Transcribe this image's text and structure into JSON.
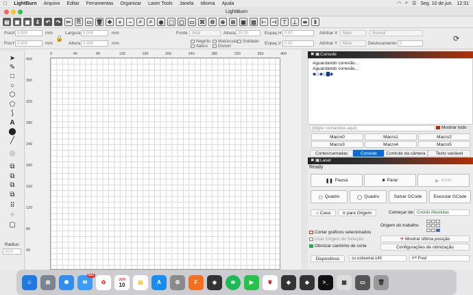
{
  "menubar": {
    "app": "LightBurn",
    "items": [
      "Arquivo",
      "Editar",
      "Ferramentas",
      "Organizar",
      "Laser Tools",
      "Janela",
      "Idioma",
      "Ajuda"
    ],
    "date": "Seg. 10 de jun.",
    "time": "12:31"
  },
  "window": {
    "title": "LightBurn"
  },
  "props": {
    "posx_label": "PosX",
    "posx_value": "0.000",
    "posx_unit": "mm",
    "posy_label": "PosY",
    "posy_value": "0.000",
    "posy_unit": "mm",
    "width_label": "Largura",
    "width_value": "0.000",
    "width_unit": "mm",
    "height_label": "Altura",
    "height_value": "0.000",
    "height_unit": "mm",
    "font_label": "Fonte",
    "font_value": "Arial",
    "alt_label": "Altura",
    "alt_value": "25.00",
    "esph_label": "Espaç.H",
    "esph_value": "0.00",
    "espv_label": "Espaç.V",
    "espv_value": "0.00",
    "alignx_label": "Alinhar X",
    "alignx_value": "Meio",
    "aligny_label": "Alinhar Y",
    "aligny_value": "Meio",
    "style_value": "Normal",
    "offset_label": "Deslocamento",
    "offset_value": "0",
    "bold": "Negrito",
    "upper": "Maiúscula",
    "welded": "Soldado",
    "italic": "Itálico",
    "distort": "Distort"
  },
  "ruler": {
    "top": [
      "0",
      "40",
      "80",
      "120",
      "160",
      "200",
      "240",
      "280",
      "320",
      "360",
      "400"
    ],
    "left": [
      "400",
      "360",
      "320",
      "280",
      "240",
      "200",
      "160",
      "120",
      "80",
      "40"
    ]
  },
  "leftpanel": {
    "radius_label": "Radius:",
    "radius_value": "10.0"
  },
  "console": {
    "header": "Console",
    "lines": [
      "Aguardando conexão...",
      "Aguardando conexão...",
      "◆◇◆◇▇◆"
    ],
    "placeholder": "(digite comandos aqui)",
    "show_all": "Mostrar tudo",
    "macros": [
      "Macro0",
      "Macro1",
      "Macro2",
      "Macro3",
      "Macro4",
      "Macro5"
    ]
  },
  "tabs": [
    "Cortes/camadas",
    "Console",
    "Controle da câmera",
    "Texto variável"
  ],
  "laser": {
    "header": "Laser",
    "status": "Ready",
    "pause": "Pausa",
    "stop": "Parar",
    "start": "Início",
    "frame1": "Quadro",
    "frame2": "Quadro",
    "save_gcode": "Salvar GCode",
    "run_gcode": "Executar GCode",
    "home": "Casa",
    "goto_origin": "Ir para Origem",
    "start_from_label": "Começar de:",
    "start_from_value": "Coords Absolutas",
    "job_origin_label": "Origem do trabalho",
    "cut_selected": "Cortar gráficos selecionados",
    "use_selection_origin": "Usar Origem de Seleção",
    "optimize_path": "Otimizar caminho de corte",
    "show_last_pos": "Mostrar última posição",
    "optim_settings": "Configurações de otimização",
    "devices": "Dispositivos",
    "port": "cu.usbserial-140",
    "profile": "Fred"
  },
  "dock": {
    "calendar_month": "JUN",
    "calendar_day": "10",
    "mail_badge": "522"
  },
  "colors": {
    "accent": "#0a6cd8",
    "panel_header_start": "#222222",
    "panel_header_end": "#b0300a"
  }
}
